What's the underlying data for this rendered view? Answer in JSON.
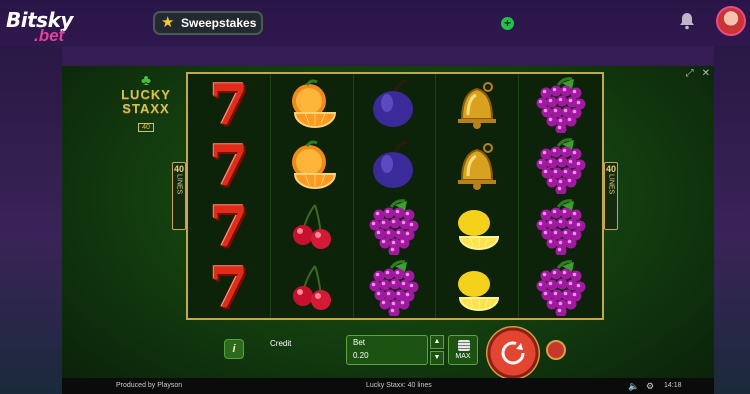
{
  "header": {
    "logo_line1": "Bitsky",
    "logo_line2": ".bet",
    "sweepstakes_label": "Sweepstakes",
    "plus_symbol": "+"
  },
  "game": {
    "logo_top": "LUCKY",
    "logo_bottom": "STAXX",
    "logo_badge": "40",
    "lines_left_number": "40",
    "lines_left_label": "LINES",
    "lines_right_number": "40",
    "lines_right_label": "LINES",
    "reels": [
      [
        "seven",
        "seven",
        "seven",
        "seven"
      ],
      [
        "orange",
        "orange",
        "cherry",
        "cherry"
      ],
      [
        "plum",
        "plum",
        "grapes",
        "grapes"
      ],
      [
        "bell",
        "bell",
        "lemon",
        "lemon"
      ],
      [
        "grapes",
        "grapes",
        "grapes",
        "grapes"
      ]
    ],
    "controls": {
      "info_label": "i",
      "credit_label": "Credit",
      "bet_label": "Bet",
      "bet_value": "0.20",
      "max_label": "MAX"
    },
    "footer": {
      "produced_by": "Produced by Playson",
      "game_name": "Lucky Staxx: 40 lines",
      "clock": "14:18"
    }
  },
  "colors": {
    "brand_pink": "#e0409a",
    "spin_red": "#e34531",
    "gold": "#c7a848"
  }
}
